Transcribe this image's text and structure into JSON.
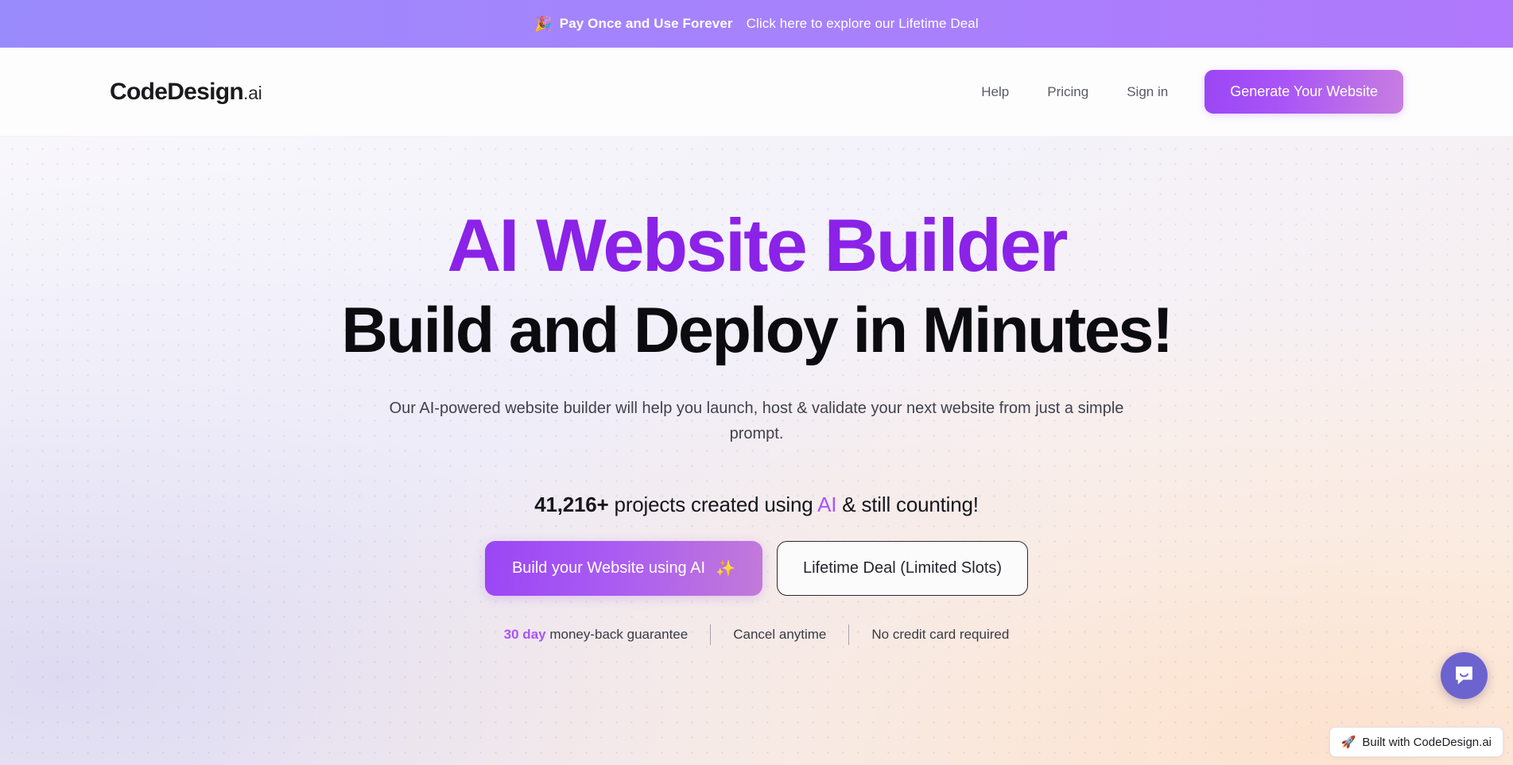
{
  "promo_banner": {
    "emoji": "🎉",
    "emoji_name": "party-popper-icon",
    "strong_text": "Pay Once and Use Forever",
    "link_text": "Click here to explore our Lifetime Deal",
    "gradient_from": "#9a8bfc",
    "gradient_to": "#b078fc"
  },
  "header": {
    "logo_main": "CodeDesign",
    "logo_suffix": ".ai",
    "nav": [
      {
        "label": "Help"
      },
      {
        "label": "Pricing"
      },
      {
        "label": "Sign in"
      }
    ],
    "cta_label": "Generate Your Website",
    "cta_color": "#a855f7"
  },
  "hero": {
    "headline_line1": "AI Website Builder",
    "headline_line1_color": "#8b22e8",
    "headline_line2": "Build and Deploy in Minutes!",
    "headline_line2_color": "#0c0c10",
    "subtitle": "Our AI-powered website builder will help you launch, host & validate your next website from just a simple prompt.",
    "stat": {
      "count": "41,216+",
      "middle": " projects created using ",
      "ai_word": "AI",
      "tail": " & still counting!"
    },
    "primary_cta": {
      "label": "Build your Website using AI",
      "emoji": "✨",
      "emoji_name": "sparkles-icon"
    },
    "secondary_cta": {
      "label": "Lifetime Deal (Limited Slots)"
    },
    "guarantees": {
      "money_back_strong": "30 day",
      "money_back_rest": " money-back guarantee",
      "cancel": "Cancel anytime",
      "no_card": "No credit card required"
    }
  },
  "widgets": {
    "chat_label": "chat-bubble",
    "built_badge": {
      "emoji": "🚀",
      "emoji_name": "rocket-icon",
      "label": "Built with CodeDesign.ai"
    }
  }
}
